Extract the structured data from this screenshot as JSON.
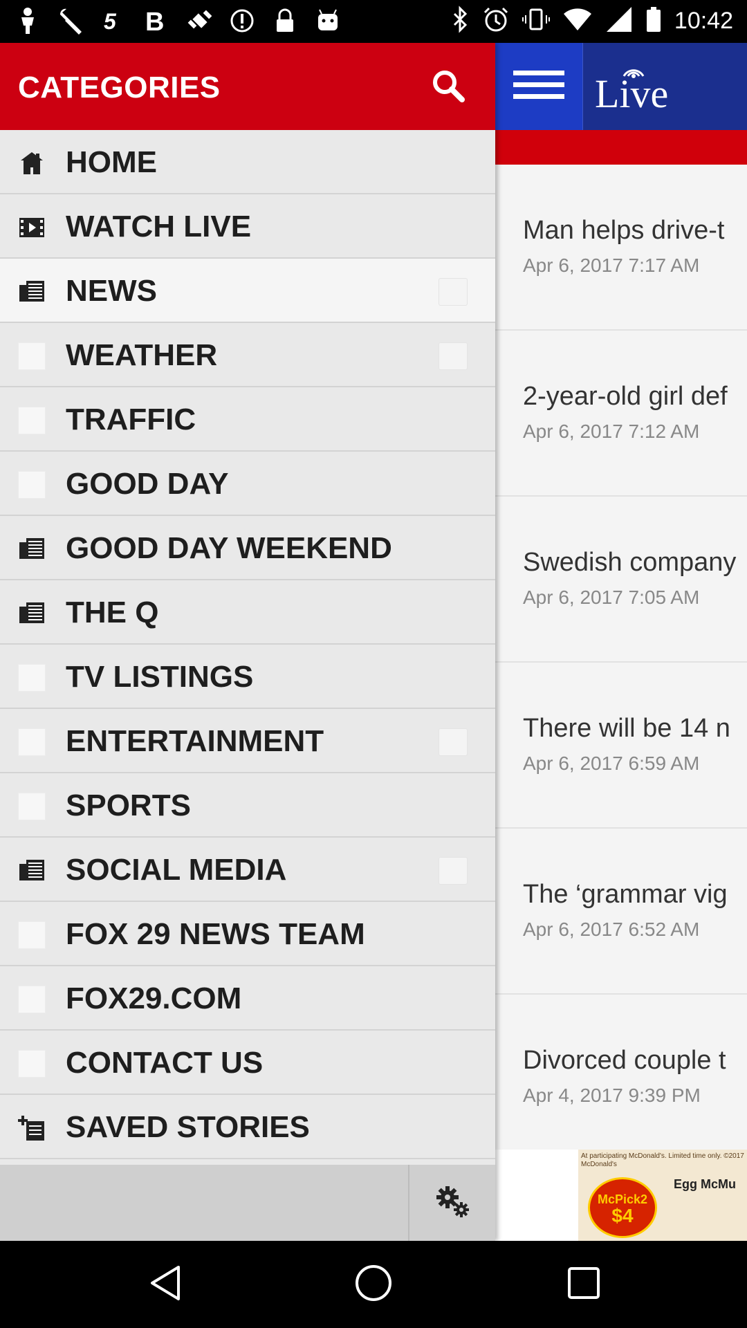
{
  "status_bar": {
    "time": "10:42",
    "left_icons": [
      "person-icon",
      "wrench-icon",
      "five-icon",
      "bold-b-icon",
      "fake-gps-icon",
      "alert-icon",
      "lock-icon",
      "android-icon"
    ],
    "right_icons": [
      "bluetooth-icon",
      "alarm-icon",
      "vibrate-icon",
      "wifi-icon",
      "signal-icon",
      "battery-icon"
    ]
  },
  "drawer": {
    "title": "CATEGORIES",
    "items": [
      {
        "label": "HOME",
        "icon": "home-icon",
        "expandable": false
      },
      {
        "label": "WATCH LIVE",
        "icon": "film-icon",
        "expandable": false
      },
      {
        "label": "NEWS",
        "icon": "documents-icon",
        "expandable": true,
        "active": true
      },
      {
        "label": "WEATHER",
        "icon": "blank-icon",
        "expandable": true
      },
      {
        "label": "TRAFFIC",
        "icon": "blank-icon",
        "expandable": false
      },
      {
        "label": "GOOD DAY",
        "icon": "blank-icon",
        "expandable": false
      },
      {
        "label": "GOOD DAY WEEKEND",
        "icon": "documents-icon",
        "expandable": false
      },
      {
        "label": "THE Q",
        "icon": "documents-icon",
        "expandable": false
      },
      {
        "label": "TV LISTINGS",
        "icon": "blank-icon",
        "expandable": false
      },
      {
        "label": "ENTERTAINMENT",
        "icon": "blank-icon",
        "expandable": true
      },
      {
        "label": "SPORTS",
        "icon": "blank-icon",
        "expandable": false
      },
      {
        "label": "SOCIAL MEDIA",
        "icon": "documents-icon",
        "expandable": true
      },
      {
        "label": "FOX 29 NEWS TEAM",
        "icon": "blank-icon",
        "expandable": false
      },
      {
        "label": "FOX29.COM",
        "icon": "blank-icon",
        "expandable": false
      },
      {
        "label": "CONTACT US",
        "icon": "blank-icon",
        "expandable": false
      },
      {
        "label": "SAVED STORIES",
        "icon": "add-document-icon",
        "expandable": false
      }
    ]
  },
  "content": {
    "live_label": "Live",
    "stories": [
      {
        "title": "Man helps drive-t",
        "date": "Apr 6, 2017 7:17 AM"
      },
      {
        "title": "2-year-old girl def",
        "date": "Apr 6, 2017 7:12 AM"
      },
      {
        "title": "Swedish company",
        "date": "Apr 6, 2017 7:05 AM"
      },
      {
        "title": "There will be 14 n",
        "date": "Apr 6, 2017 6:59 AM"
      },
      {
        "title": "The ‘grammar vig",
        "date": "Apr 6, 2017 6:52 AM"
      },
      {
        "title": "Divorced couple t",
        "date": "Apr 4, 2017 9:39 PM"
      }
    ],
    "ad": {
      "top_text": "At participating McDonald's. Limited time only. ©2017 McDonald's",
      "badge_line1": "McPick2",
      "badge_line2": "$4",
      "side_text": "Egg McMu"
    }
  },
  "colors": {
    "drawer_header": "#cc0011",
    "content_topbar": "#1b2f8e",
    "content_redbar": "#d0000b"
  }
}
